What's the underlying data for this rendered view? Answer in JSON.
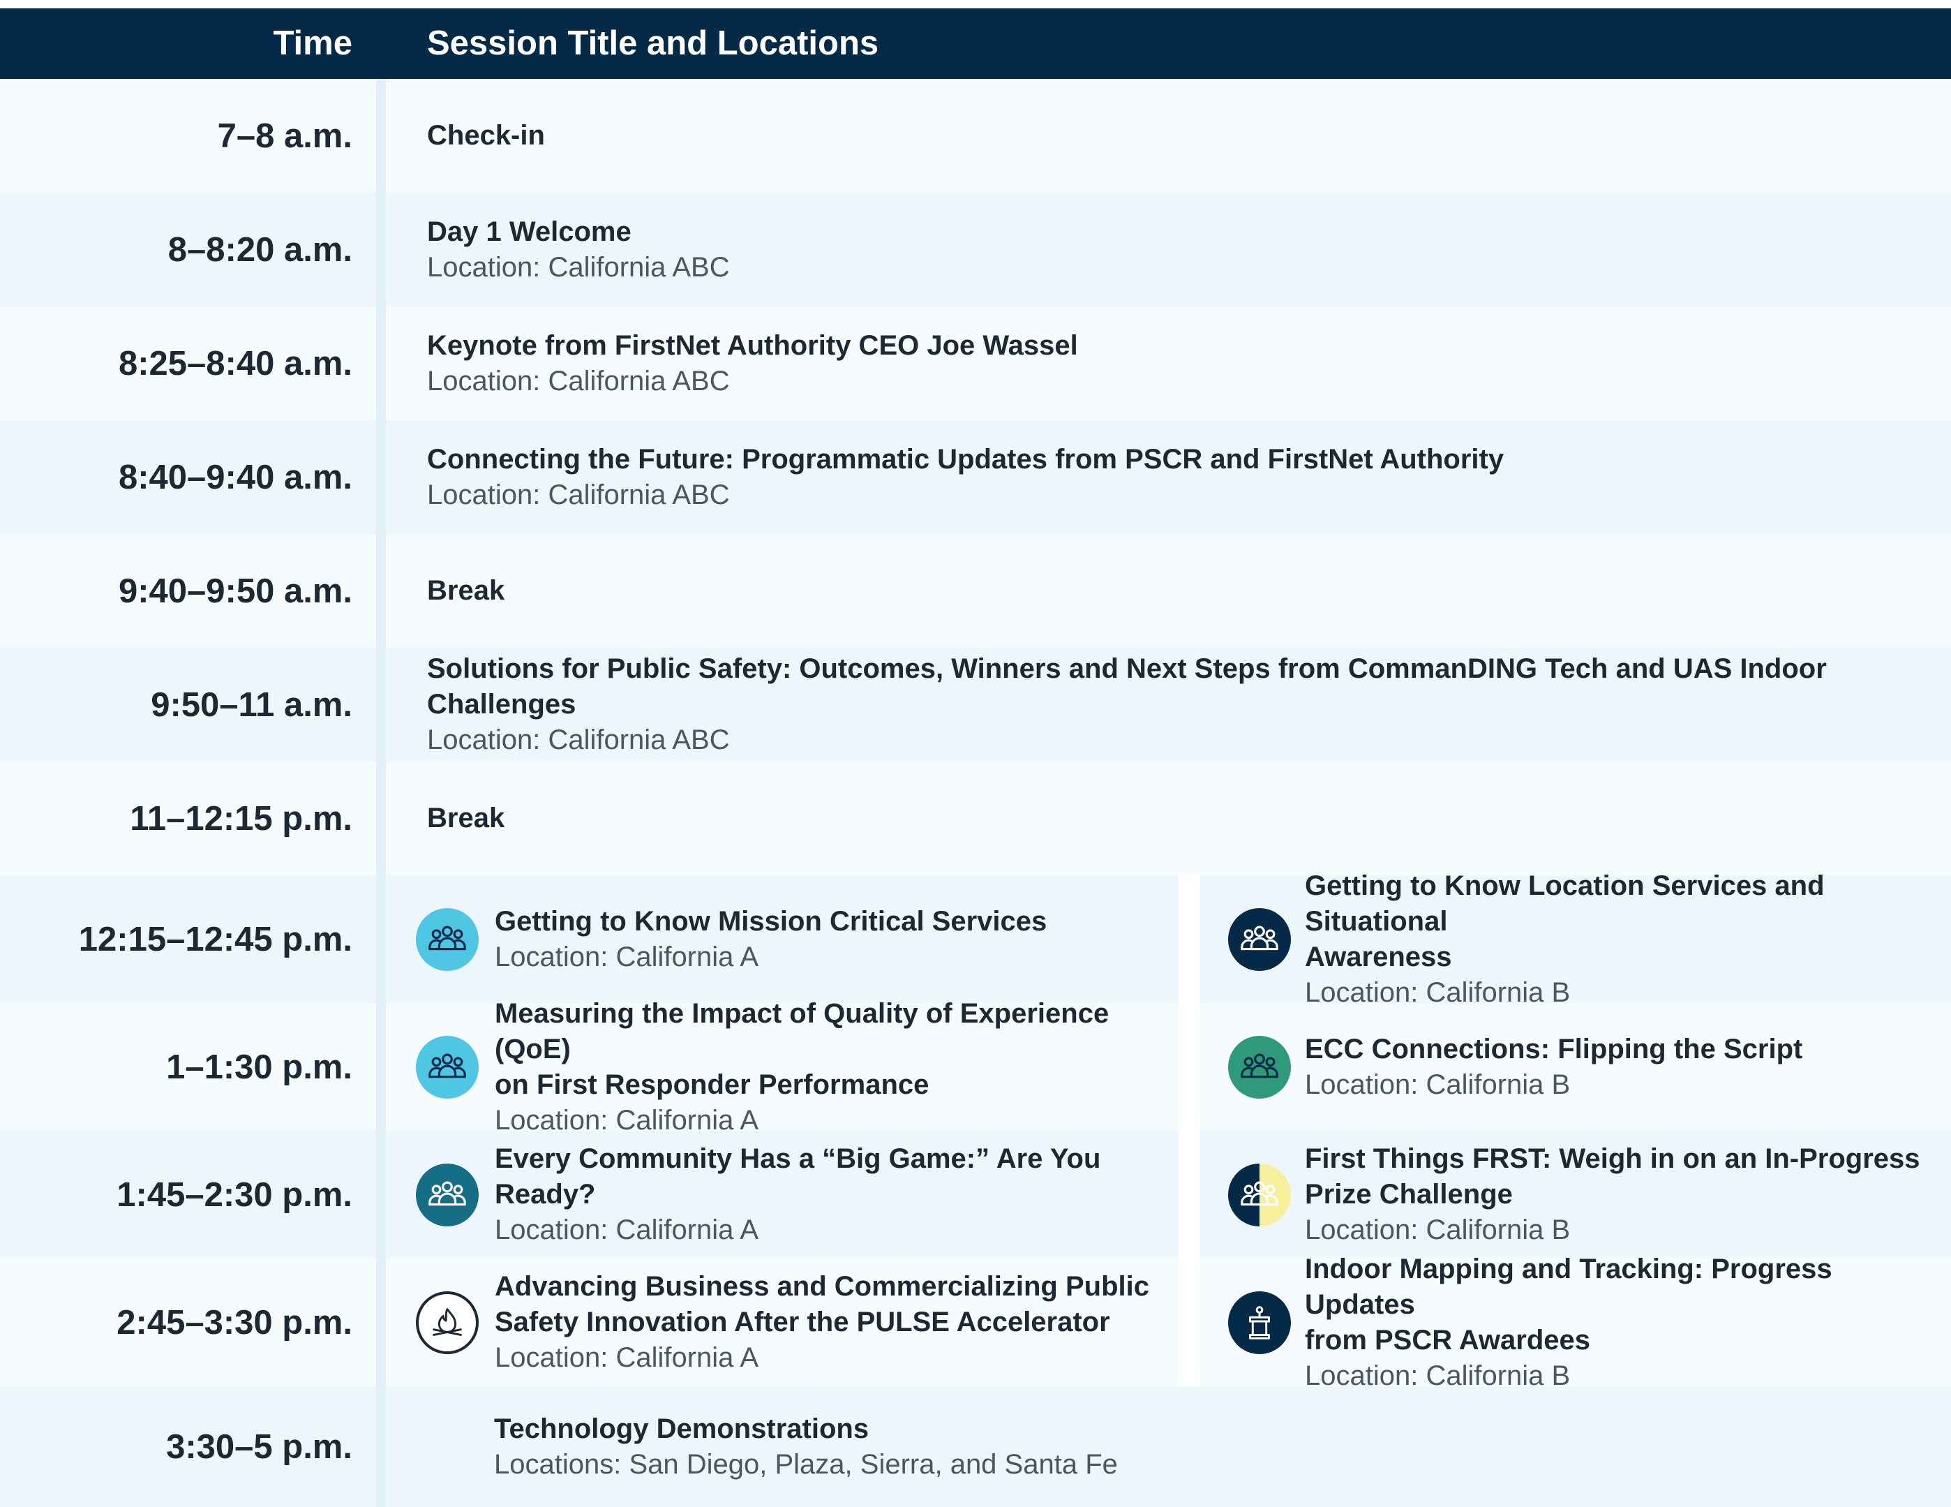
{
  "header": {
    "time_label": "Time",
    "session_label": "Session Title and Locations"
  },
  "colors": {
    "header_bg": "#042a48",
    "row_light": "#f6fbfd",
    "row_blue": "#edf6fa",
    "icon_light_blue": "#4fc6e4",
    "icon_navy": "#042a48",
    "icon_green": "#2e9a7a",
    "icon_teal": "#166d86",
    "icon_yellow": "#f6ef9b"
  },
  "rows": [
    {
      "time": "7–8 a.m.",
      "title": "Check-in"
    },
    {
      "time": "8–8:20 a.m.",
      "title": "Day 1 Welcome",
      "location": "Location: California ABC"
    },
    {
      "time": "8:25–8:40 a.m.",
      "title": "Keynote from FirstNet Authority CEO Joe Wassel",
      "location": "Location: California ABC"
    },
    {
      "time": "8:40–9:40 a.m.",
      "title": "Connecting the Future: Programmatic Updates from PSCR and FirstNet Authority",
      "location": "Location: California ABC"
    },
    {
      "time": "9:40–9:50 a.m.",
      "title": "Break"
    },
    {
      "time": "9:50–11 a.m.",
      "title": "Solutions for Public Safety: Outcomes, Winners and Next Steps from CommanDING Tech and UAS Indoor Challenges",
      "location": "Location: California ABC"
    },
    {
      "time": "11–12:15 p.m.",
      "title": "Break"
    },
    {
      "time": "12:15–12:45 p.m.",
      "left": {
        "icon": "people-group-icon",
        "title": "Getting to Know Mission Critical Services",
        "location": "Location: California A"
      },
      "right": {
        "icon": "people-group-icon",
        "title_l1": "Getting to Know Location Services and Situational",
        "title_l2": "Awareness",
        "location": "Location: California B"
      }
    },
    {
      "time": "1–1:30 p.m.",
      "left": {
        "icon": "people-group-icon",
        "title_l1": "Measuring the Impact of Quality of Experience (QoE)",
        "title_l2": "on First Responder Performance",
        "location": "Location: California A"
      },
      "right": {
        "icon": "people-group-icon",
        "title": "ECC Connections: Flipping the Script",
        "location": "Location: California B"
      }
    },
    {
      "time": "1:45–2:30 p.m.",
      "left": {
        "icon": "people-group-icon",
        "title": "Every Community Has a “Big Game:” Are You Ready?",
        "location": "Location: California A"
      },
      "right": {
        "icon": "people-group-split-icon",
        "title_l1": "First Things FRST: Weigh in on an In-Progress",
        "title_l2": "Prize Challenge",
        "location": "Location: California B"
      }
    },
    {
      "time": "2:45–3:30 p.m.",
      "left": {
        "icon": "campfire-icon",
        "title_l1": "Advancing Business and Commercializing Public",
        "title_l2": "Safety Innovation After the PULSE Accelerator",
        "location": "Location: California A"
      },
      "right": {
        "icon": "podium-icon",
        "title_l1": "Indoor Mapping and Tracking: Progress Updates",
        "title_l2": "from PSCR Awardees",
        "location": "Location: California B"
      }
    },
    {
      "time": "3:30–5 p.m.",
      "title": "Technology Demonstrations",
      "location": "Locations: San Diego, Plaza, Sierra, and Santa Fe"
    }
  ]
}
